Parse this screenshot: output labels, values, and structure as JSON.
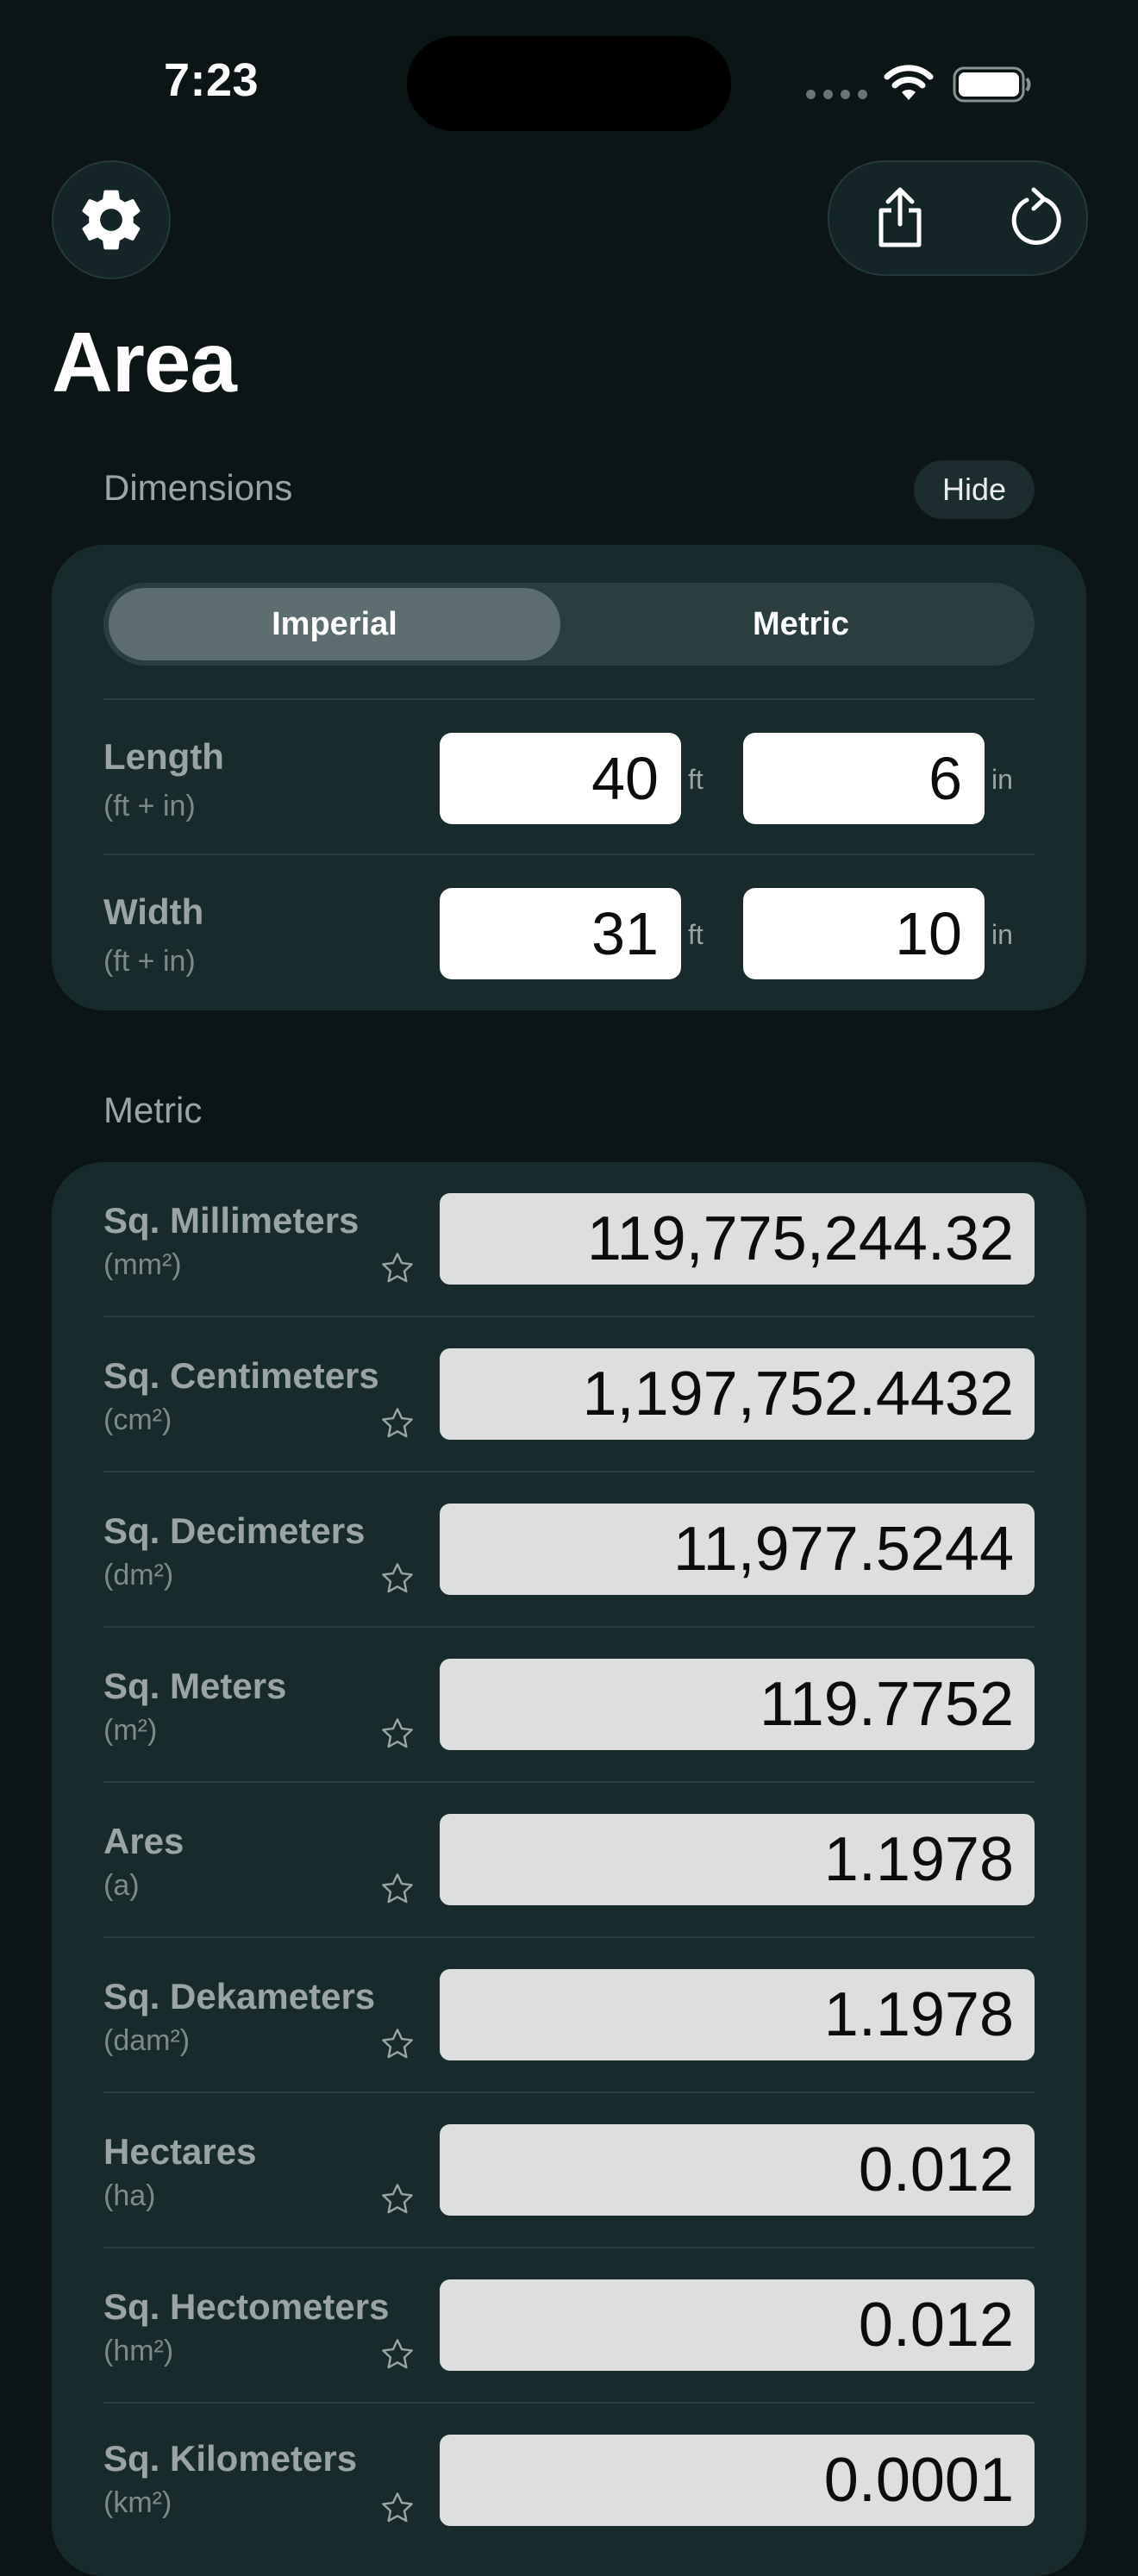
{
  "status": {
    "time": "7:23"
  },
  "icons": {
    "settings": "gear-icon",
    "share": "share-icon",
    "reset": "reset-icon",
    "favorite": "star-outline-icon"
  },
  "colors": {
    "background": "#0b1516",
    "card": "#172b2d",
    "field": "#ffffff",
    "result_field": "#dddfdf"
  },
  "page_title": "Area",
  "dimensions": {
    "header": "Dimensions",
    "hide_label": "Hide",
    "segments": {
      "imperial": "Imperial",
      "metric": "Metric",
      "selected": "Imperial"
    },
    "rows": [
      {
        "label": "Length",
        "sub": "(ft + in)",
        "ft_value": "40",
        "ft_unit": "ft",
        "in_value": "6",
        "in_unit": "in"
      },
      {
        "label": "Width",
        "sub": "(ft + in)",
        "ft_value": "31",
        "ft_unit": "ft",
        "in_value": "10",
        "in_unit": "in"
      }
    ]
  },
  "metric": {
    "header": "Metric",
    "rows": [
      {
        "label": "Sq. Millimeters",
        "unit": "(mm²)",
        "value": "119,775,244.32"
      },
      {
        "label": "Sq. Centimeters",
        "unit": "(cm²)",
        "value": "1,197,752.4432"
      },
      {
        "label": "Sq. Decimeters",
        "unit": "(dm²)",
        "value": "11,977.5244"
      },
      {
        "label": "Sq. Meters",
        "unit": "(m²)",
        "value": "119.7752"
      },
      {
        "label": "Ares",
        "unit": "(a)",
        "value": "1.1978"
      },
      {
        "label": "Sq. Dekameters",
        "unit": "(dam²)",
        "value": "1.1978"
      },
      {
        "label": "Hectares",
        "unit": "(ha)",
        "value": "0.012"
      },
      {
        "label": "Sq. Hectometers",
        "unit": "(hm²)",
        "value": "0.012"
      },
      {
        "label": "Sq. Kilometers",
        "unit": "(km²)",
        "value": "0.0001"
      }
    ]
  }
}
